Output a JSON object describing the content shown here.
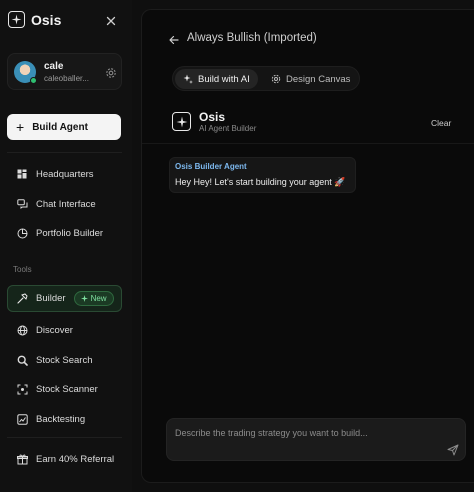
{
  "sidebar": {
    "brand": {
      "name": "Osis"
    },
    "user": {
      "name": "cale",
      "email": "caleoballer..."
    },
    "build_agent_label": "Build Agent",
    "nav_primary": [
      {
        "label": "Headquarters",
        "icon": "grid-icon"
      },
      {
        "label": "Chat Interface",
        "icon": "chat-icon"
      },
      {
        "label": "Portfolio Builder",
        "icon": "pie-chart-icon"
      }
    ],
    "section_tools_label": "Tools",
    "nav_tools": [
      {
        "label": "Builder",
        "icon": "hammer-icon",
        "badge": "New"
      },
      {
        "label": "Discover",
        "icon": "globe-icon"
      },
      {
        "label": "Stock Search",
        "icon": "search-icon"
      },
      {
        "label": "Stock Scanner",
        "icon": "scanner-icon"
      },
      {
        "label": "Backtesting",
        "icon": "chart-icon"
      }
    ],
    "referral_label": "Earn 40% Referral"
  },
  "main": {
    "page_title": "Always Bullish (Imported)",
    "tabs": [
      {
        "label": "Build with AI",
        "icon": "sparkle-icon",
        "active": true
      },
      {
        "label": "Design Canvas",
        "icon": "gear-icon",
        "active": false
      }
    ],
    "agent": {
      "name": "Osis",
      "subtitle": "AI Agent Builder"
    },
    "clear_label": "Clear",
    "messages": [
      {
        "author": "Osis Builder Agent",
        "text": "Hey Hey! Let's start building your agent 🚀"
      }
    ],
    "composer": {
      "placeholder": "Describe the trading strategy you want to build...",
      "value": ""
    }
  },
  "colors": {
    "background": "#0f0f0f",
    "accent_green": "#7fe0a0",
    "author_blue": "#7db8ee"
  }
}
